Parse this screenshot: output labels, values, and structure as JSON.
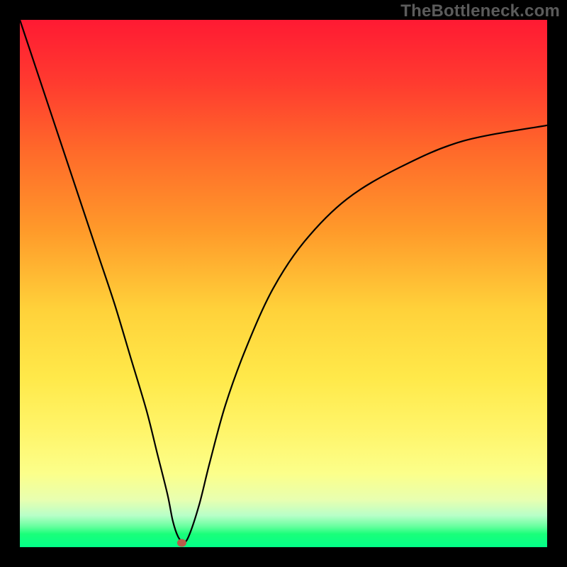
{
  "watermark": {
    "text": "TheBottleneck.com"
  },
  "chart_data": {
    "type": "line",
    "title": "",
    "xlabel": "",
    "ylabel": "",
    "xlim": [
      0,
      100
    ],
    "ylim": [
      0,
      100
    ],
    "series": [
      {
        "name": "curve",
        "x": [
          0,
          3,
          6,
          9,
          12,
          15,
          18,
          21,
          24,
          26,
          28,
          29,
          30,
          31,
          32,
          34,
          36,
          39,
          43,
          48,
          54,
          62,
          72,
          84,
          100
        ],
        "y": [
          100,
          91,
          82,
          73,
          64,
          55,
          46,
          36,
          26,
          18,
          10,
          5,
          2,
          1,
          2,
          8,
          16,
          27,
          38,
          49,
          58,
          66,
          72,
          77,
          80
        ]
      }
    ],
    "marker": {
      "x": 30.7,
      "y": 0.8
    },
    "gradient_note": "background is a vertical red→orange→yellow→green gradient"
  }
}
